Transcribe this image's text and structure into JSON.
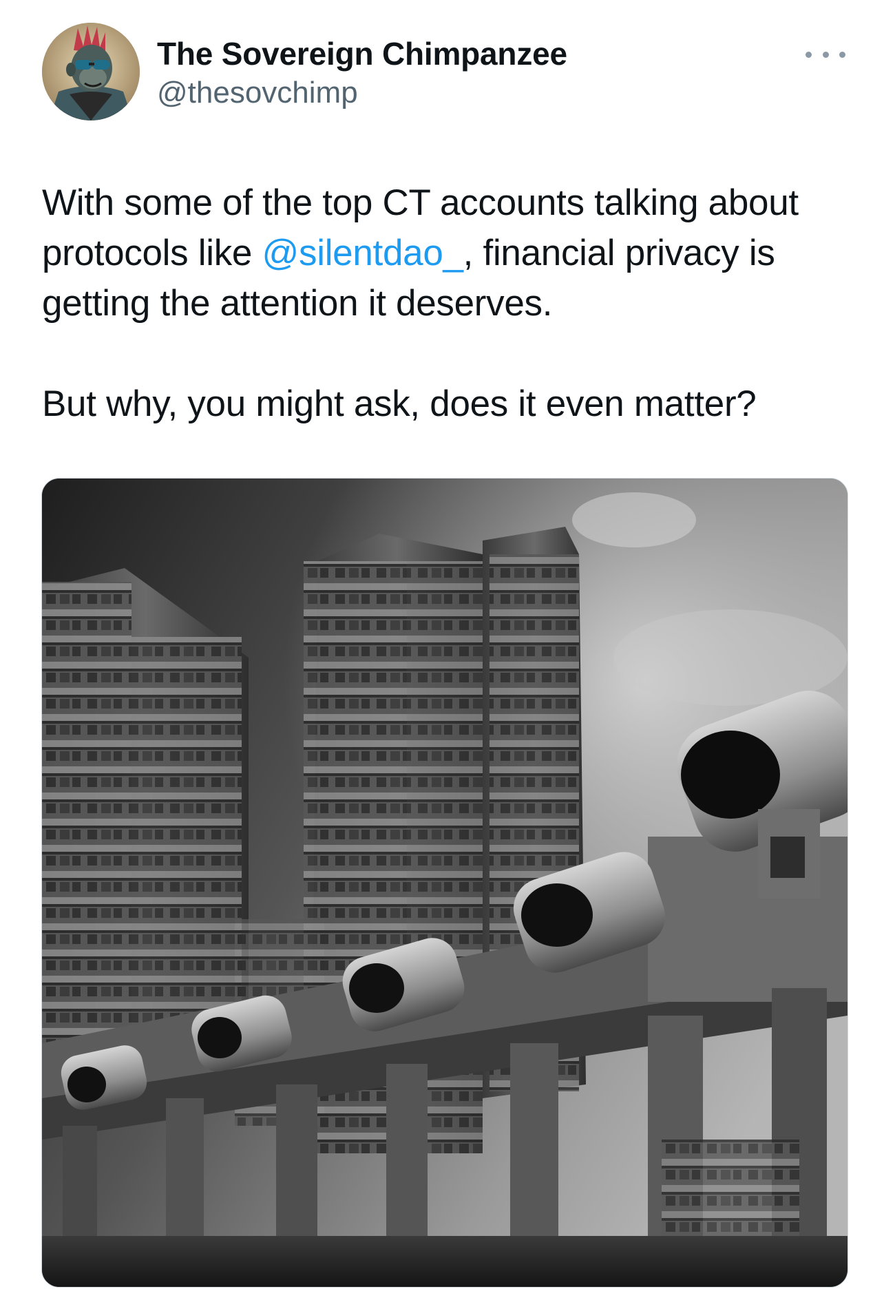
{
  "tweet": {
    "author": {
      "display_name": "The Sovereign Chimpanzee",
      "handle": "@thesovchimp",
      "avatar_icon": "chimpanzee-avatar-icon"
    },
    "more_icon": "more-horizontal-icon",
    "text": {
      "line1_before": "With some of the top CT accounts talking about protocols like ",
      "mention": "@silentdao_",
      "line1_after": ", financial privacy is getting the attention it deserves.",
      "line2": "But why, you might ask, does it even matter?"
    },
    "media": {
      "kind": "image",
      "subject": "surveillance-cameras-brutalist-towers"
    },
    "colors": {
      "text": "#0f1419",
      "secondary": "#536471",
      "link": "#1d9bf0"
    }
  }
}
